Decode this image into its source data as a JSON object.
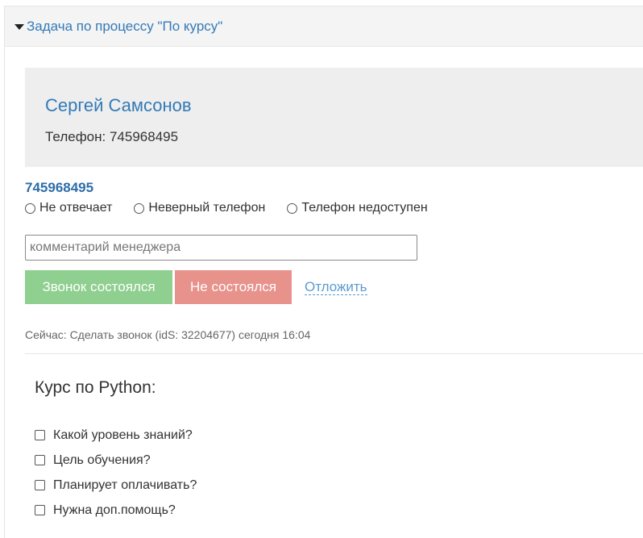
{
  "panel": {
    "title": "Задача по процессу \"По курсу\""
  },
  "contact": {
    "name": "Сергей Самсонов",
    "phone_line": "Телефон: 745968495"
  },
  "call": {
    "phone": "745968495",
    "outcomes": [
      {
        "label": "Не отвечает",
        "selected": false
      },
      {
        "label": "Неверный телефон",
        "selected": false
      },
      {
        "label": "Телефон недоступен",
        "selected": false
      }
    ],
    "comment_placeholder": "комментарий менеджера",
    "comment_value": "",
    "success_label": "Звонок состоялся",
    "fail_label": "Не состоялся",
    "postpone_label": "Отложить",
    "status": "Сейчас: Сделать звонок (idS: 32204677) сегодня 16:04"
  },
  "course": {
    "title": "Курс по Python:",
    "questions": [
      {
        "label": "Какой уровень знаний?",
        "checked": false
      },
      {
        "label": "Цель обучения?",
        "checked": false
      },
      {
        "label": "Планирует оплачивать?",
        "checked": false
      },
      {
        "label": "Нужна доп.помощь?",
        "checked": false
      }
    ]
  },
  "colors": {
    "link": "#337ab7",
    "success_button": "#8fcf8f",
    "fail_button": "#e8928c",
    "card_background": "#eeeeee"
  }
}
